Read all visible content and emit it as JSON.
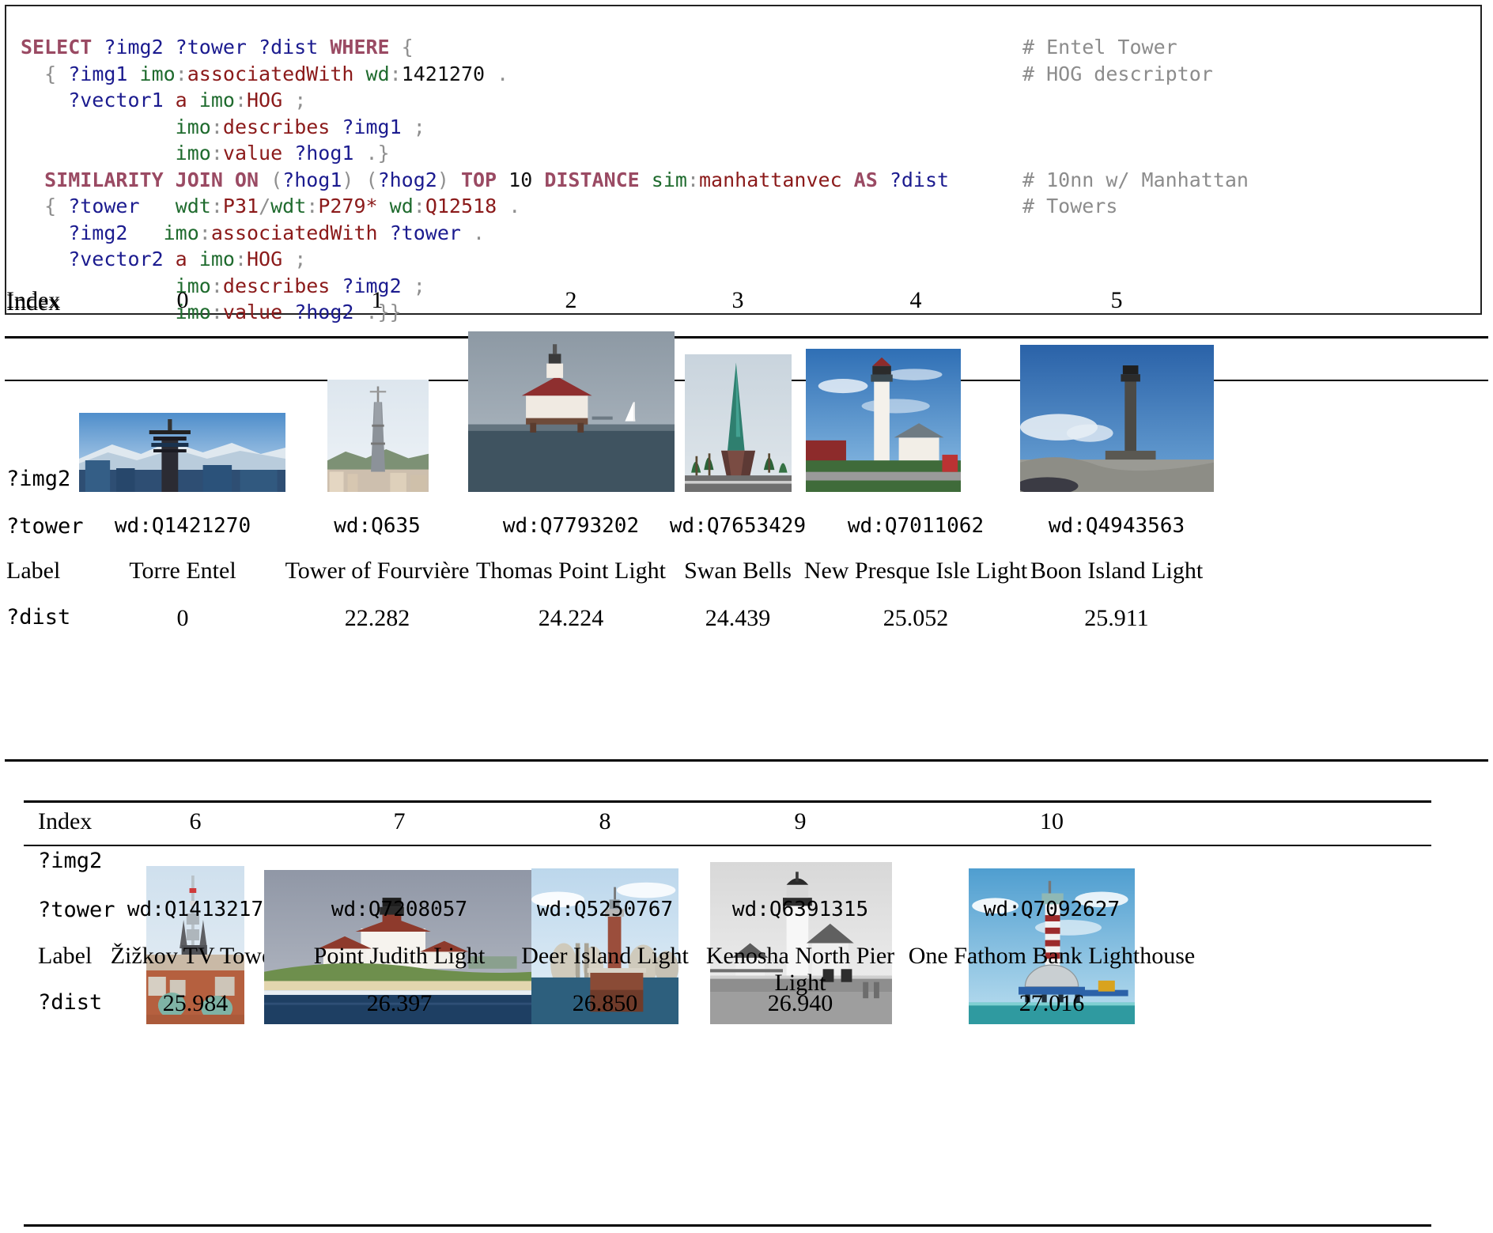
{
  "query": {
    "lines": [
      [
        {
          "t": "SELECT ",
          "c": "kw"
        },
        {
          "t": "?img2 ?tower ?dist ",
          "c": "var"
        },
        {
          "t": "WHERE ",
          "c": "kw"
        },
        {
          "t": "{",
          "c": "pun"
        }
      ],
      [
        {
          "t": "  { ",
          "c": "pun"
        },
        {
          "t": "?img1 ",
          "c": "var"
        },
        {
          "t": "imo",
          "c": "pfx"
        },
        {
          "t": ":",
          "c": "pun"
        },
        {
          "t": "associatedWith ",
          "c": "lit"
        },
        {
          "t": "wd",
          "c": "pfx"
        },
        {
          "t": ":",
          "c": "pun"
        },
        {
          "t": "1421270 ",
          "c": "num"
        },
        {
          "t": ".",
          "c": "pun"
        }
      ],
      [
        {
          "t": "    ?vector1 ",
          "c": "var"
        },
        {
          "t": "a ",
          "c": "lit"
        },
        {
          "t": "imo",
          "c": "pfx"
        },
        {
          "t": ":",
          "c": "pun"
        },
        {
          "t": "HOG ",
          "c": "lit"
        },
        {
          "t": ";",
          "c": "pun"
        }
      ],
      [
        {
          "t": "             ",
          "c": "pun"
        },
        {
          "t": "imo",
          "c": "pfx"
        },
        {
          "t": ":",
          "c": "pun"
        },
        {
          "t": "describes ",
          "c": "lit"
        },
        {
          "t": "?img1 ",
          "c": "var"
        },
        {
          "t": ";",
          "c": "pun"
        }
      ],
      [
        {
          "t": "             ",
          "c": "pun"
        },
        {
          "t": "imo",
          "c": "pfx"
        },
        {
          "t": ":",
          "c": "pun"
        },
        {
          "t": "value ",
          "c": "lit"
        },
        {
          "t": "?hog1 ",
          "c": "var"
        },
        {
          "t": ".}",
          "c": "pun"
        }
      ],
      [
        {
          "t": "  SIMILARITY JOIN ON ",
          "c": "kw"
        },
        {
          "t": "(",
          "c": "pun"
        },
        {
          "t": "?hog1",
          "c": "var"
        },
        {
          "t": ") (",
          "c": "pun"
        },
        {
          "t": "?hog2",
          "c": "var"
        },
        {
          "t": ") ",
          "c": "pun"
        },
        {
          "t": "TOP ",
          "c": "kw"
        },
        {
          "t": "10 ",
          "c": "num"
        },
        {
          "t": "DISTANCE ",
          "c": "kw"
        },
        {
          "t": "sim",
          "c": "pfx"
        },
        {
          "t": ":",
          "c": "pun"
        },
        {
          "t": "manhattanvec ",
          "c": "lit"
        },
        {
          "t": "AS ",
          "c": "kw"
        },
        {
          "t": "?dist",
          "c": "var"
        }
      ],
      [
        {
          "t": "  { ",
          "c": "pun"
        },
        {
          "t": "?tower   ",
          "c": "var"
        },
        {
          "t": "wdt",
          "c": "pfx"
        },
        {
          "t": ":",
          "c": "pun"
        },
        {
          "t": "P31",
          "c": "lit"
        },
        {
          "t": "/",
          "c": "pun"
        },
        {
          "t": "wdt",
          "c": "pfx"
        },
        {
          "t": ":",
          "c": "pun"
        },
        {
          "t": "P279* ",
          "c": "lit"
        },
        {
          "t": "wd",
          "c": "pfx"
        },
        {
          "t": ":",
          "c": "pun"
        },
        {
          "t": "Q12518 ",
          "c": "lit"
        },
        {
          "t": ".",
          "c": "pun"
        }
      ],
      [
        {
          "t": "    ?img2   ",
          "c": "var"
        },
        {
          "t": "imo",
          "c": "pfx"
        },
        {
          "t": ":",
          "c": "pun"
        },
        {
          "t": "associatedWith ",
          "c": "lit"
        },
        {
          "t": "?tower ",
          "c": "var"
        },
        {
          "t": ".",
          "c": "pun"
        }
      ],
      [
        {
          "t": "    ?vector2 ",
          "c": "var"
        },
        {
          "t": "a ",
          "c": "lit"
        },
        {
          "t": "imo",
          "c": "pfx"
        },
        {
          "t": ":",
          "c": "pun"
        },
        {
          "t": "HOG ",
          "c": "lit"
        },
        {
          "t": ";",
          "c": "pun"
        }
      ],
      [
        {
          "t": "             ",
          "c": "pun"
        },
        {
          "t": "imo",
          "c": "pfx"
        },
        {
          "t": ":",
          "c": "pun"
        },
        {
          "t": "describes ",
          "c": "lit"
        },
        {
          "t": "?img2 ",
          "c": "var"
        },
        {
          "t": ";",
          "c": "pun"
        }
      ],
      [
        {
          "t": "             ",
          "c": "pun"
        },
        {
          "t": "imo",
          "c": "pfx"
        },
        {
          "t": ":",
          "c": "pun"
        },
        {
          "t": "value ",
          "c": "lit"
        },
        {
          "t": "?hog2 ",
          "c": "var"
        },
        {
          "t": ".}}",
          "c": "pun"
        }
      ]
    ],
    "comments": [
      "# Entel Tower",
      "# HOG descriptor",
      "",
      "",
      "",
      "# 10nn w/ Manhattan",
      "# Towers",
      "",
      "",
      "",
      ""
    ]
  },
  "row_labels": {
    "index": "Index",
    "img2": "?img2",
    "tower": "?tower",
    "label": "Label",
    "dist": "?dist"
  },
  "table1": {
    "index": [
      "0",
      "1",
      "2",
      "3",
      "4",
      "5"
    ],
    "tower": [
      "wd:Q1421270",
      "wd:Q635",
      "wd:Q7793202",
      "wd:Q7653429",
      "wd:Q7011062",
      "wd:Q4943563"
    ],
    "label": [
      "Torre Entel",
      "Tower of Fourvière",
      "Thomas Point Light",
      "Swan Bells",
      "New Presque Isle Light",
      "Boon Island Light"
    ],
    "dist": [
      "0",
      "22.282",
      "24.224",
      "24.439",
      "25.052",
      "25.911"
    ],
    "image_alt": [
      "torre-entel-photo",
      "tower-of-fourviere-photo",
      "thomas-point-light-photo",
      "swan-bells-photo",
      "new-presque-isle-light-photo",
      "boon-island-light-photo"
    ]
  },
  "table2": {
    "index": [
      "6",
      "7",
      "8",
      "9",
      "10"
    ],
    "tower": [
      "wd:Q1413217",
      "wd:Q7208057",
      "wd:Q5250767",
      "wd:Q6391315",
      "wd:Q7092627"
    ],
    "label": [
      "Žižkov TV Tower",
      "Point Judith Light",
      "Deer Island Light",
      "Kenosha North Pier Light",
      "One Fathom Bank Lighthouse"
    ],
    "dist": [
      "25.984",
      "26.397",
      "26.850",
      "26.940",
      "27.016"
    ],
    "image_alt": [
      "zizkov-tv-tower-photo",
      "point-judith-light-photo",
      "deer-island-light-photo",
      "kenosha-north-pier-light-photo",
      "one-fathom-bank-lighthouse-photo"
    ]
  },
  "colors": {
    "keyword": "#9a4a63",
    "variable": "#1b1b8f",
    "prefix": "#1f6b2e",
    "literal": "#8b1a1a",
    "comment": "#8c8c8c",
    "rule": "#000000"
  }
}
